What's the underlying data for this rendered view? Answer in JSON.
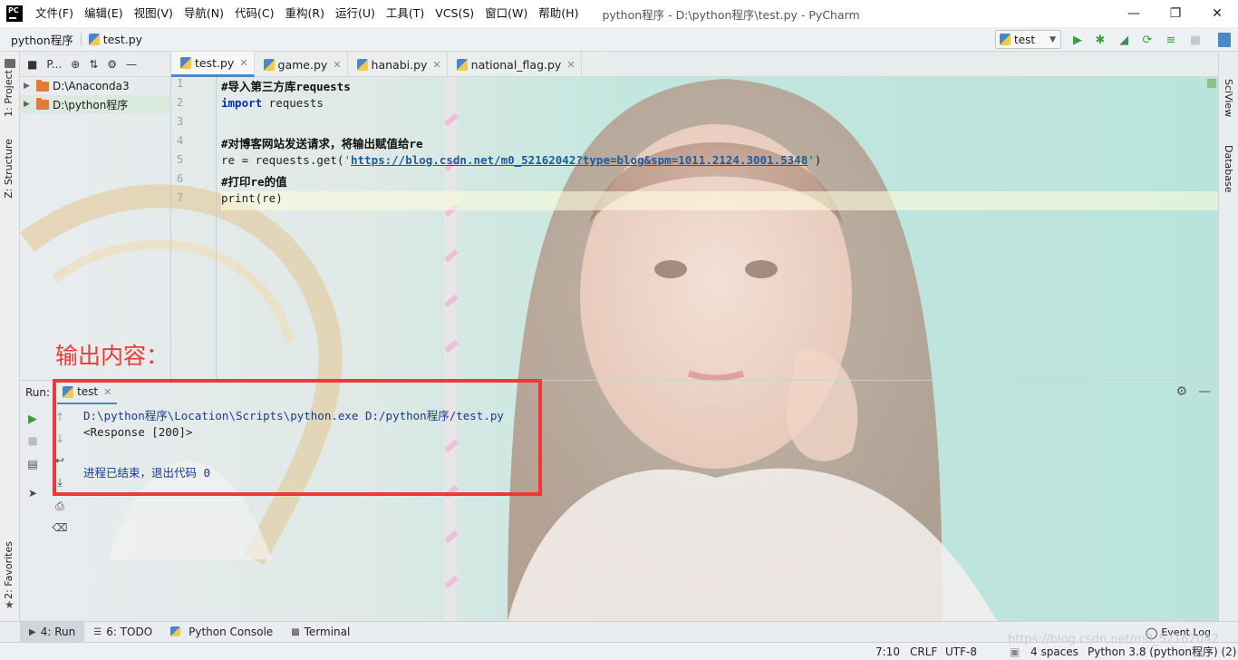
{
  "titlebar": {
    "logo": "PC",
    "menu": [
      "文件(F)",
      "编辑(E)",
      "视图(V)",
      "导航(N)",
      "代码(C)",
      "重构(R)",
      "运行(U)",
      "工具(T)",
      "VCS(S)",
      "窗口(W)",
      "帮助(H)"
    ],
    "title": "python程序 - D:\\python程序\\test.py - PyCharm"
  },
  "navbar": {
    "crumbs": [
      "python程序",
      "test.py"
    ],
    "run_config": "test"
  },
  "left_stripe": {
    "project": "1: Project",
    "structure": "Z: Structure",
    "favorites": "2: Favorites"
  },
  "right_stripe": {
    "sciview": "SciView",
    "database": "Database"
  },
  "project": {
    "header_label": "P...",
    "items": [
      "D:\\Anaconda3",
      "D:\\python程序"
    ]
  },
  "editor": {
    "tabs": [
      "test.py",
      "game.py",
      "hanabi.py",
      "national_flag.py"
    ],
    "line_numbers": [
      "1",
      "2",
      "3",
      "4",
      "5",
      "6",
      "7"
    ],
    "lines": {
      "l1_comment": "#导入第三方库requests",
      "l2_kw": "import",
      "l2_rest": " requests",
      "l4_comment": "#对博客网站发送请求，将输出赋值给re",
      "l5_pre": "re = requests.get(",
      "l5_q1": "'",
      "l5_url": "https://blog.csdn.net/m0_52162042?type=blog&spm=1011.2124.3001.5348",
      "l5_q2": "'",
      "l5_post": ")",
      "l6_comment": "#打印re的值",
      "l7_code": "print(re)"
    }
  },
  "annotation": "输出内容：",
  "run": {
    "label": "Run:",
    "tab": "test",
    "console": {
      "cmd": "D:\\python程序\\Location\\Scripts\\python.exe D:/python程序/test.py",
      "out": "<Response [200]>",
      "exit": "进程已结束，退出代码 0"
    }
  },
  "bottom_tabs": {
    "run": "4: Run",
    "todo": "6: TODO",
    "console": "Python Console",
    "terminal": "Terminal",
    "event_log": "Event Log"
  },
  "status": {
    "position": "7:10",
    "line_sep": "CRLF",
    "encoding": "UTF-8",
    "indent": "4 spaces",
    "interpreter": "Python 3.8 (python程序) (2)"
  },
  "watermark": "https://blog.csdn.net/m0_52162042",
  "colors": {
    "accent": "#4a88c7",
    "annotation_red": "#ee3a36",
    "run_green": "#3c9f3c"
  }
}
